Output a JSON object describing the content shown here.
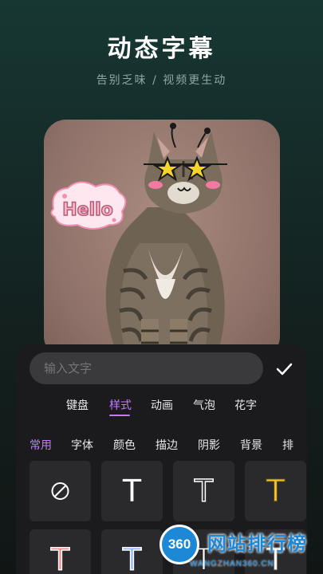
{
  "promo": {
    "headline": "动态字幕",
    "subline": "告别乏味 / 视频更生动"
  },
  "photo": {
    "sticker_text": "Hello",
    "decorations": [
      "antenna-icon",
      "star-glasses-icon",
      "blush-icon",
      "cat-mouth-icon"
    ]
  },
  "editor": {
    "input_placeholder": "输入文字",
    "confirm_icon": "checkmark-icon",
    "tabs": [
      {
        "label": "键盘",
        "active": false
      },
      {
        "label": "样式",
        "active": true
      },
      {
        "label": "动画",
        "active": false
      },
      {
        "label": "气泡",
        "active": false
      },
      {
        "label": "花字",
        "active": false
      }
    ],
    "subtabs": [
      {
        "label": "常用",
        "active": true
      },
      {
        "label": "字体",
        "active": false
      },
      {
        "label": "颜色",
        "active": false
      },
      {
        "label": "描边",
        "active": false
      },
      {
        "label": "阴影",
        "active": false
      },
      {
        "label": "背景",
        "active": false
      },
      {
        "label": "排",
        "active": false
      }
    ],
    "styles": [
      {
        "name": "none",
        "icon": "no-style-icon"
      },
      {
        "name": "white-fill",
        "glyph": "T",
        "fill": "#ffffff",
        "stroke": "none"
      },
      {
        "name": "white-outline",
        "glyph": "T",
        "fill": "#1b1b1d",
        "stroke": "#ffffff"
      },
      {
        "name": "yellow",
        "glyph": "T",
        "fill": "#f2c230",
        "stroke": "#2a2a2d"
      },
      {
        "name": "pink",
        "glyph": "T",
        "fill": "#f08b8b",
        "stroke": "#ffffff"
      },
      {
        "name": "blue",
        "glyph": "T",
        "fill": "#8bb4f0",
        "stroke": "#ffffff"
      },
      {
        "name": "white-black-outline",
        "glyph": "T",
        "fill": "#ffffff",
        "stroke": "#222222"
      },
      {
        "name": "white-thin",
        "glyph": "T",
        "fill": "#ffffff",
        "stroke": "#777777"
      }
    ]
  },
  "watermark": {
    "logo_text": "360",
    "name": "网站排行榜",
    "url": "WANGZHAN360.CN"
  },
  "colors": {
    "accent": "#c07bff",
    "panel": "#1b1b1d",
    "tile": "#2a2a2d",
    "watermark_blue": "#1d88d6"
  }
}
